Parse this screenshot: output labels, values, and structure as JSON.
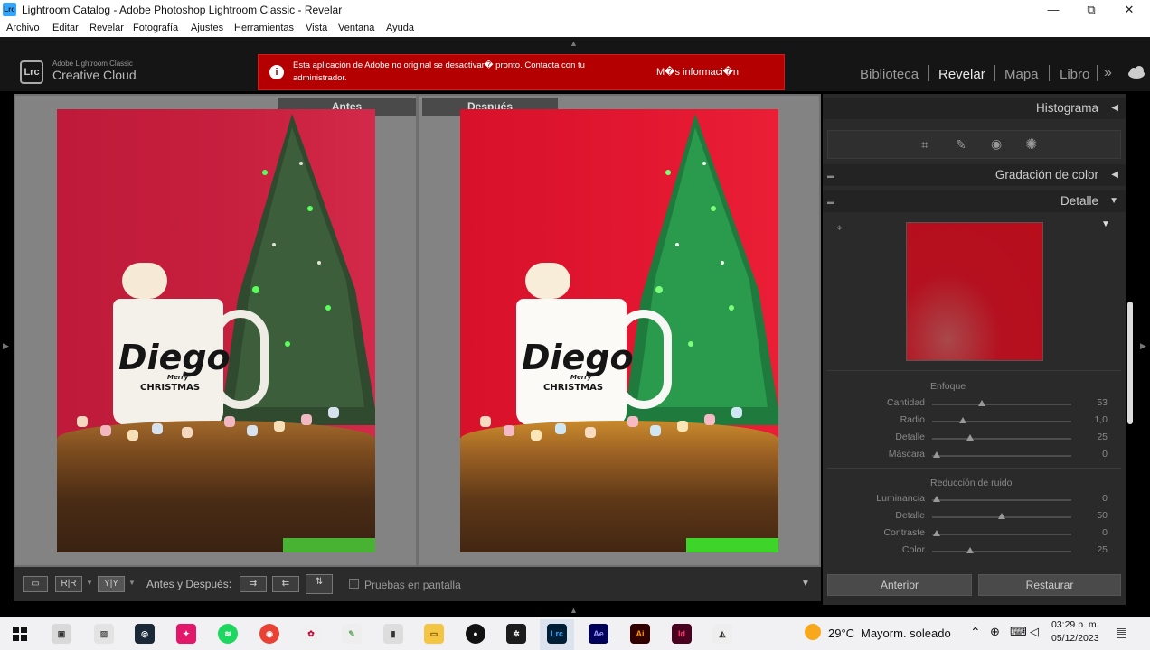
{
  "window": {
    "logo": "Lrc",
    "title": "Lightroom Catalog - Adobe Photoshop Lightroom Classic - Revelar",
    "minimize": "—",
    "maximize": "⧉",
    "close": "✕"
  },
  "menu": [
    "Archivo",
    "Editar",
    "Revelar",
    "Fotografía",
    "Ajustes",
    "Herramientas",
    "Vista",
    "Ventana",
    "Ayuda"
  ],
  "brand": {
    "badge": "Lrc",
    "line1": "Adobe Lightroom Classic",
    "line2": "Creative Cloud"
  },
  "alert": {
    "icon": "i",
    "message": "Esta aplicación de Adobe no original se desactivar� pronto. Contacta con tu administrador.",
    "more": "M�s informaci�n"
  },
  "modules": {
    "items": [
      "Biblioteca",
      "Revelar",
      "Mapa",
      "Libro"
    ],
    "active": "Revelar",
    "more": "»"
  },
  "compare": {
    "before_label": "Antes",
    "after_label": "Después",
    "mug_name": "Diego",
    "mug_sub1": "Merry",
    "mug_sub2": "CHRISTMAS"
  },
  "toolbar": {
    "view_loupe": "▭",
    "view_rr": "R|R",
    "view_yy": "Y|Y",
    "label": "Antes y Después:",
    "copy_after_to_before": "⇉",
    "copy_before_to_after": "⇇",
    "swap": "⇅",
    "softproof": "Pruebas en pantalla",
    "menu_arrow": "▼"
  },
  "panels": {
    "histogram": "Histograma",
    "color_grading": "Gradación de color",
    "detail": "Detalle",
    "sharpen_title": "Enfoque",
    "noise_title": "Reducción de ruido",
    "sharpen": [
      {
        "label": "Cantidad",
        "value": "53",
        "pos": 0.36
      },
      {
        "label": "Radio",
        "value": "1,0",
        "pos": 0.22
      },
      {
        "label": "Detalle",
        "value": "25",
        "pos": 0.27
      },
      {
        "label": "Máscara",
        "value": "0",
        "pos": 0.03
      }
    ],
    "noise": [
      {
        "label": "Luminancia",
        "value": "0",
        "pos": 0.03
      },
      {
        "label": "Detalle",
        "value": "50",
        "pos": 0.5
      },
      {
        "label": "Contraste",
        "value": "0",
        "pos": 0.03
      },
      {
        "label": "Color",
        "value": "25",
        "pos": 0.27
      }
    ],
    "prev_button": "Anterior",
    "reset_button": "Restaurar"
  },
  "taskbar": {
    "weather_temp": "29°C",
    "weather_desc": "Mayorm. soleado",
    "time": "03:29 p. m.",
    "date": "05/12/2023",
    "apps": [
      "Lrc",
      "Ae",
      "Ai",
      "Id"
    ]
  },
  "colors": {
    "alert_red": "#b40000",
    "panel_dark": "#2a2a2a",
    "backdrop_red": "#c8142a"
  }
}
